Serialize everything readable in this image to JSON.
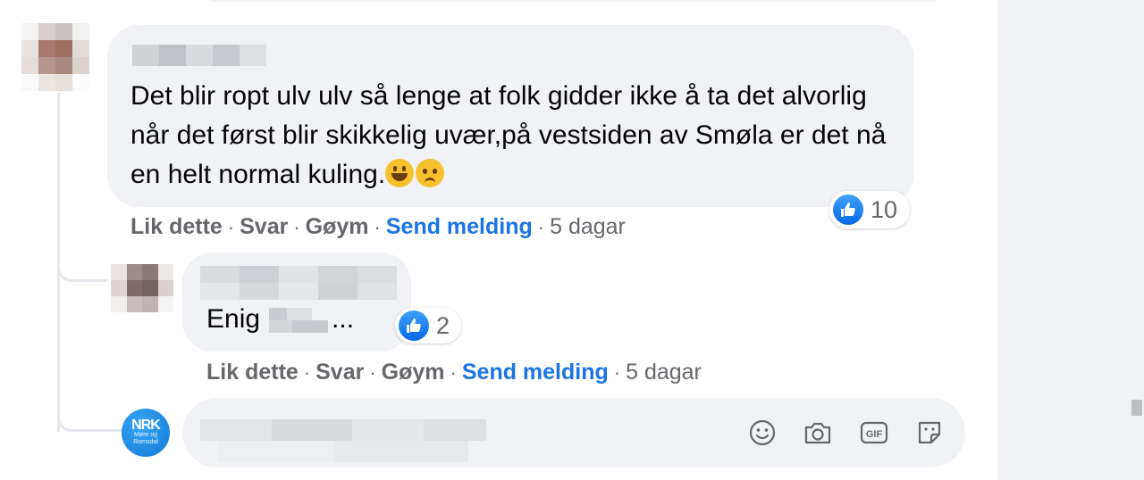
{
  "comment_1": {
    "text_before_emoji": "Det blir ropt ulv ulv så lenge at folk gidder ikke å ta det alvorlig når det først blir skikkelig uvær,på vestsiden av Smøla er det nå en helt normal kuling.",
    "emojis": [
      "grinning-face",
      "worried-face"
    ],
    "reaction_count": "10",
    "actions": {
      "like": "Lik dette",
      "reply": "Svar",
      "hide": "Gøym",
      "send_message": "Send melding",
      "time": "5 dagar"
    }
  },
  "comment_2": {
    "text": "Enig",
    "text_suffix": "...",
    "reaction_count": "2",
    "actions": {
      "like": "Lik dette",
      "reply": "Svar",
      "hide": "Gøym",
      "send_message": "Send melding",
      "time": "5 dagar"
    }
  },
  "page_avatar": {
    "logo_text": "NRK",
    "logo_subtext": "Møre og Romsdal"
  },
  "composer": {
    "icons": [
      "emoji-icon",
      "camera-icon",
      "gif-icon",
      "sticker-icon"
    ]
  },
  "colors": {
    "bubble": "#f0f2f5",
    "link_blue": "#1b74e4",
    "meta_gray": "#65676b",
    "like_blue": "#0766e4"
  }
}
